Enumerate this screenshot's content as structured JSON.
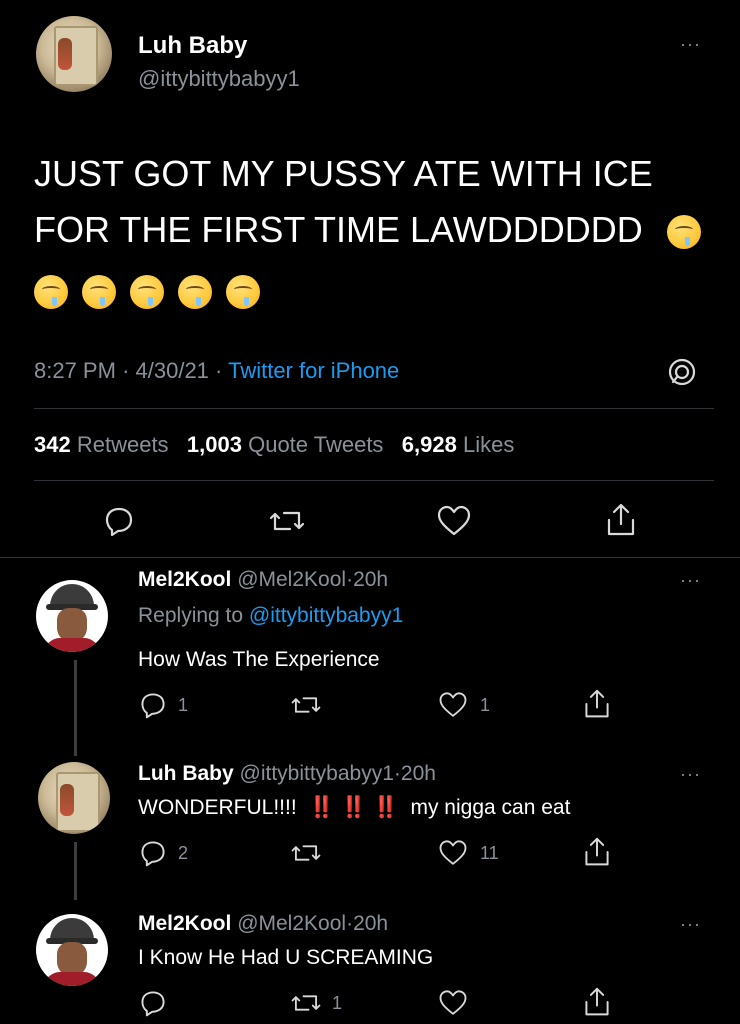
{
  "main_tweet": {
    "name": "Luh Baby",
    "handle": "@ittybittybabyy1",
    "text_line1": "JUST GOT MY PUSSY ATE WITH ICE",
    "text_line2": "FOR THE FIRST TIME LAWDDDDDD",
    "emoji_name": "drooling-face",
    "time": "8:27 PM",
    "date": "4/30/21",
    "source": "Twitter for iPhone",
    "sep": "·",
    "stats": {
      "retweets_count": "342",
      "retweets_label": "Retweets",
      "quotes_count": "1,003",
      "quotes_label": "Quote Tweets",
      "likes_count": "6,928",
      "likes_label": "Likes"
    }
  },
  "replies": [
    {
      "name": "Mel2Kool",
      "handle": "@Mel2Kool",
      "time": "20h",
      "replying_prefix": "Replying to",
      "replying_handle": "@ittybittybabyy1",
      "text": "How Was The Experience",
      "reply_count": "1",
      "retweet_count": "",
      "like_count": "1"
    },
    {
      "name": "Luh Baby",
      "handle": "@ittybittybabyy1",
      "time": "20h",
      "text": "WONDERFUL!!!!",
      "bangs": "‼️ ‼️ ‼️",
      "text_after": "my nigga can eat",
      "reply_count": "2",
      "retweet_count": "",
      "like_count": "11"
    },
    {
      "name": "Mel2Kool",
      "handle": "@Mel2Kool",
      "time": "20h",
      "text": "I Know He Had U SCREAMING",
      "reply_count": "",
      "retweet_count": "1",
      "like_count": ""
    }
  ],
  "more_label": "···",
  "colors": {
    "background": "#000000",
    "link": "#1d9bf0",
    "muted": "#8b9198",
    "bang": "#e0245e"
  }
}
